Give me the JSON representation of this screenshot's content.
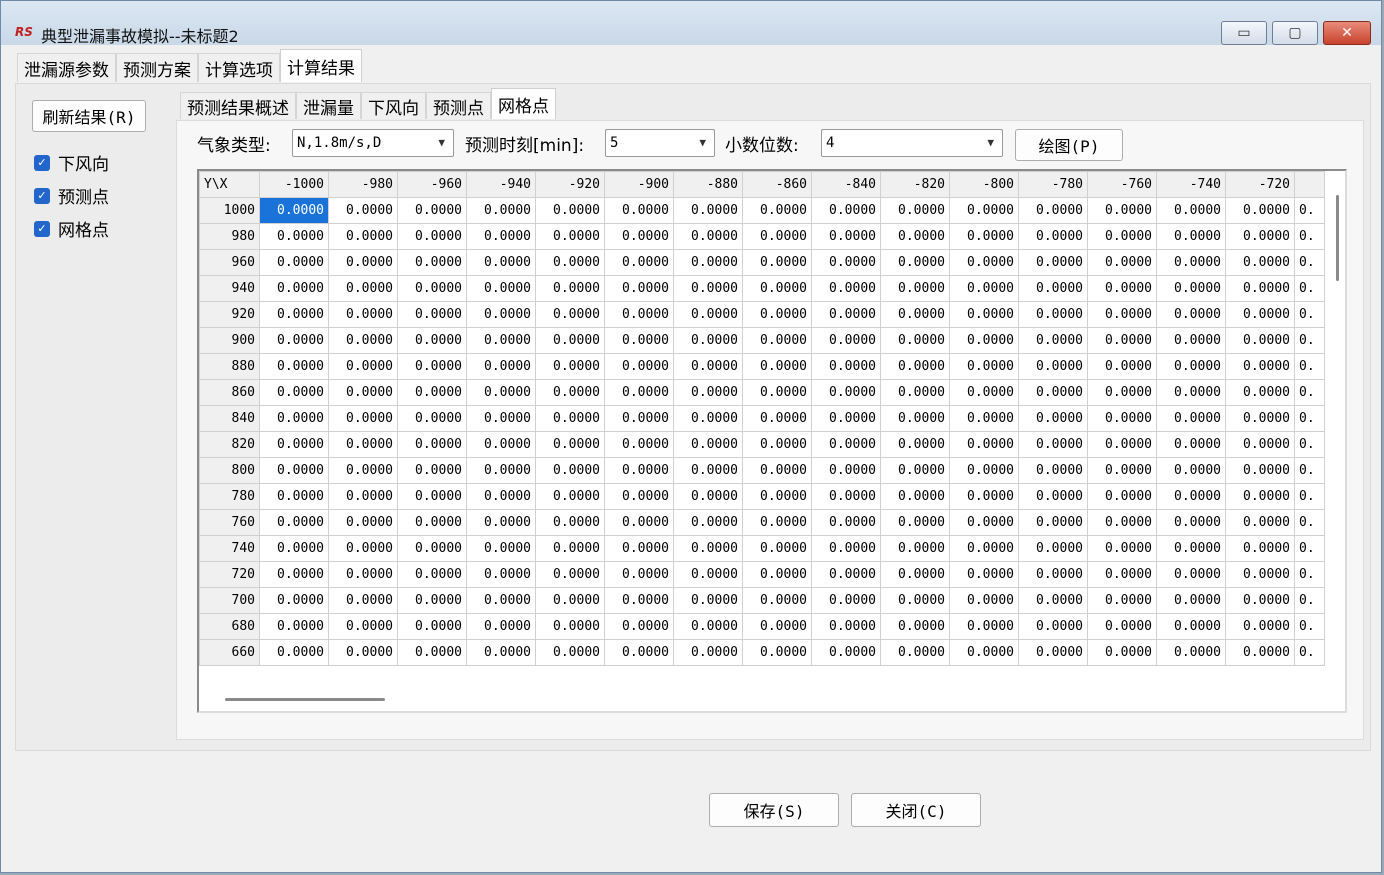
{
  "window": {
    "icon_text": "RS",
    "title": "典型泄漏事故模拟--未标题2",
    "minimize_glyph": "▭",
    "maximize_glyph": "▢",
    "close_glyph": "✕"
  },
  "main_tabs": [
    "泄漏源参数",
    "预测方案",
    "计算选项",
    "计算结果"
  ],
  "main_tabs_active": 3,
  "sidebar": {
    "refresh_label": "刷新结果(R)",
    "checkboxes": [
      {
        "label": "下风向",
        "checked": true
      },
      {
        "label": "预测点",
        "checked": true
      },
      {
        "label": "网格点",
        "checked": true
      }
    ]
  },
  "sub_tabs": [
    "预测结果概述",
    "泄漏量",
    "下风向",
    "预测点",
    "网格点"
  ],
  "sub_tabs_active": 4,
  "controls": {
    "weather_label": "气象类型:",
    "weather_value": "N,1.8m/s,D",
    "time_label": "预测时刻[min]:",
    "time_value": "5",
    "decimals_label": "小数位数:",
    "decimals_value": "4",
    "plot_label": "绘图(P)"
  },
  "grid": {
    "corner": "Y\\X",
    "columns": [
      "-1000",
      "-980",
      "-960",
      "-940",
      "-920",
      "-900",
      "-880",
      "-860",
      "-840",
      "-820",
      "-800",
      "-780",
      "-760",
      "-740",
      "-720"
    ],
    "partial_column": "",
    "rows": [
      "1000",
      "980",
      "960",
      "940",
      "920",
      "900",
      "880",
      "860",
      "840",
      "820",
      "800",
      "780",
      "760",
      "740",
      "720",
      "700",
      "680",
      "660"
    ],
    "cell_value": "0.0000",
    "partial_cell_value": "0.",
    "selected": {
      "row": 0,
      "col": 0
    },
    "selected_color": "#1a73d9"
  },
  "footer": {
    "save_label": "保存(S)",
    "close_label": "关闭(C)"
  }
}
